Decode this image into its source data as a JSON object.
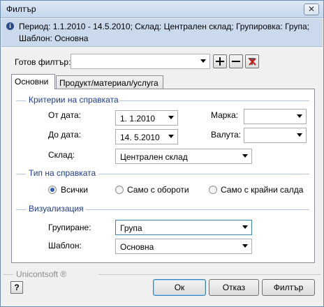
{
  "window": {
    "title": "Филтър",
    "close_glyph": "✕"
  },
  "info": {
    "icon": "info-icon",
    "text": "Период: 1.1.2010 - 14.5.2010; Склад: Централен склад; Групировка: Група; Шаблон: Основна"
  },
  "ready_filter": {
    "label": "Готов филтър:",
    "value": "",
    "add_icon": "plus-icon",
    "remove_icon": "minus-icon",
    "clear_icon": "filter-clear-icon"
  },
  "tabs": [
    {
      "label": "Основни",
      "active": true
    },
    {
      "label": "Продукт/материал/услуга",
      "active": false
    }
  ],
  "criteria": {
    "title": "Критерии на справката",
    "from_date_label": "От дата:",
    "from_date_value": "1.  1.2010",
    "to_date_label": "До дата:",
    "to_date_value": "14.  5.2010",
    "warehouse_label": "Склад:",
    "warehouse_value": "Централен склад",
    "brand_label": "Марка:",
    "brand_value": "",
    "currency_label": "Валута:",
    "currency_value": ""
  },
  "report_type": {
    "title": "Тип на справката",
    "options": [
      {
        "label": "Всички",
        "checked": true
      },
      {
        "label": "Само с обороти",
        "checked": false
      },
      {
        "label": "Само с крайни салда",
        "checked": false
      }
    ]
  },
  "visualization": {
    "title": "Визуализация",
    "grouping_label": "Групиране:",
    "grouping_value": "Група",
    "template_label": "Шаблон:",
    "template_value": "Основна"
  },
  "footer": {
    "brand": "Unicontsoft ®",
    "help_glyph": "?",
    "ok_label": "Ок",
    "cancel_label": "Отказ",
    "filter_label": "Филтър"
  },
  "colors": {
    "section_title": "#1e3c8c",
    "info_bar": "#cbd9ec",
    "radio_checked": "#2d5fb4"
  }
}
